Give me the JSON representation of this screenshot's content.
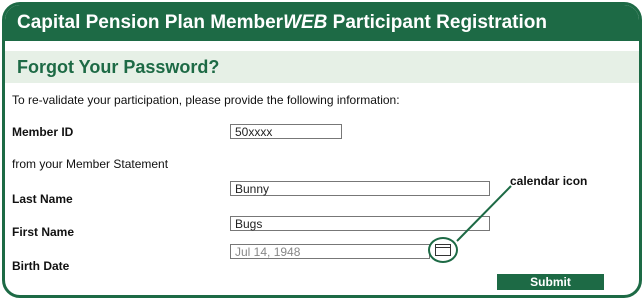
{
  "header": {
    "title_prefix": "Capital Pension Plan Member",
    "title_emph": "WEB",
    "title_suffix": " Participant Registration",
    "subtitle": "Forgot Your Password?"
  },
  "form": {
    "intro": "To re-validate your participation, please provide the following information:",
    "member_id_label": "Member ID",
    "member_id_value": "50xxxx",
    "member_id_note": "from your Member Statement",
    "last_name_label": "Last Name",
    "last_name_value": "Bunny",
    "first_name_label": "First Name",
    "first_name_value": "Bugs",
    "birth_date_label": "Birth Date",
    "birth_date_value": "Jul 14, 1948",
    "submit_label": "Submit"
  },
  "annotation": {
    "text": "calendar icon"
  },
  "icons": {
    "calendar": "calendar-icon"
  },
  "colors": {
    "brand": "#1d6a45",
    "subheader_bg": "#e6f0e6"
  }
}
